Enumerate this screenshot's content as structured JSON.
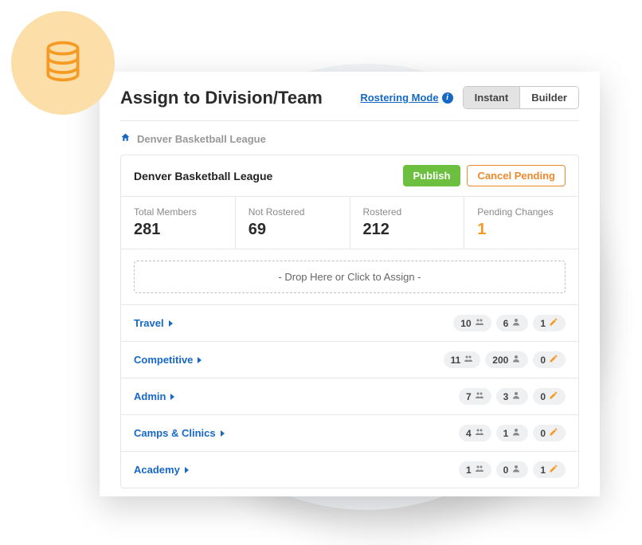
{
  "header": {
    "title": "Assign to Division/Team",
    "rostering_label": "Rostering Mode",
    "toggle": {
      "instant": "Instant",
      "builder": "Builder"
    }
  },
  "breadcrumb": {
    "league": "Denver Basketball League"
  },
  "card": {
    "title": "Denver Basketball League",
    "publish_label": "Publish",
    "cancel_label": "Cancel Pending",
    "stats": {
      "total_label": "Total Members",
      "total_value": "281",
      "not_rostered_label": "Not Rostered",
      "not_rostered_value": "69",
      "rostered_label": "Rostered",
      "rostered_value": "212",
      "pending_label": "Pending Changes",
      "pending_value": "1"
    },
    "dropzone_label": "- Drop Here or Click to Assign -"
  },
  "divisions": [
    {
      "name": "Travel",
      "teams": "10",
      "members": "6",
      "pending": "1"
    },
    {
      "name": "Competitive",
      "teams": "11",
      "members": "200",
      "pending": "0"
    },
    {
      "name": "Admin",
      "teams": "7",
      "members": "3",
      "pending": "0"
    },
    {
      "name": "Camps & Clinics",
      "teams": "4",
      "members": "1",
      "pending": "0"
    },
    {
      "name": "Academy",
      "teams": "1",
      "members": "0",
      "pending": "1"
    }
  ]
}
